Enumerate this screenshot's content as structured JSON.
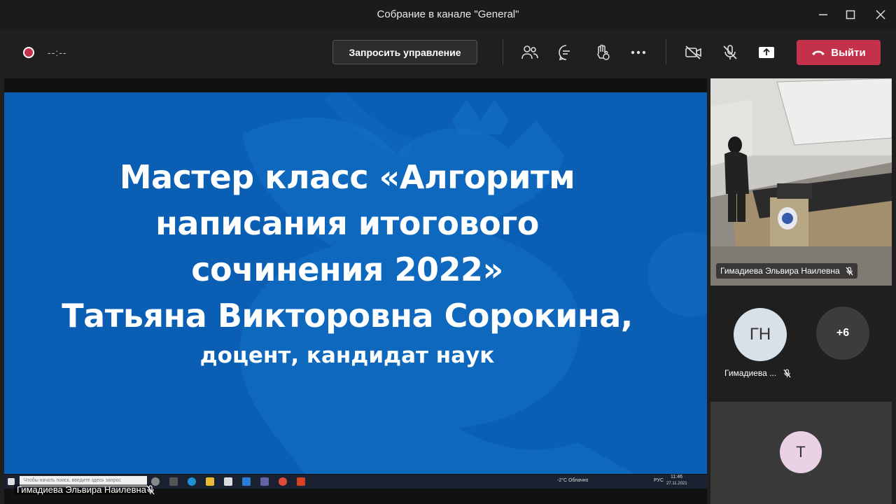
{
  "window": {
    "title": "Собрание в канале \"General\"",
    "minimize_icon": "minimize-icon",
    "maximize_icon": "maximize-icon",
    "close_icon": "close-icon"
  },
  "toolbar": {
    "timer": "--:--",
    "request_control_label": "Запросить управление",
    "leave_label": "Выйти",
    "icons": [
      "participants-icon",
      "chat-icon",
      "raise-hand-icon",
      "more-icon",
      "camera-off-icon",
      "mic-off-icon",
      "share-screen-icon"
    ],
    "leave_color": "#c4314b",
    "record_color": "#c4314b"
  },
  "slide": {
    "lines": [
      "Мастер класс «Алгоритм",
      "написания итогового",
      "сочинения 2022»",
      "Татьяна Викторовна Сорокина,"
    ],
    "subtitle": "доцент, кандидат наук",
    "background": "#0a5fb4"
  },
  "taskbar": {
    "search_placeholder": "Чтобы начать поиск, введите здесь запрос",
    "weather": "-2°C Облачно",
    "lang": "РУС",
    "time": "11:46",
    "date": "27.11.2021"
  },
  "stage": {
    "presenter_name": "Гимадиева Эльвира Наилевна"
  },
  "participants": {
    "video_name": "Гимадиева Эльвира Наилевна",
    "tile2_initials": "ГН",
    "tile2_name": "Гимадиева ...",
    "more_count": "+6",
    "tile3_initials": "Т"
  }
}
